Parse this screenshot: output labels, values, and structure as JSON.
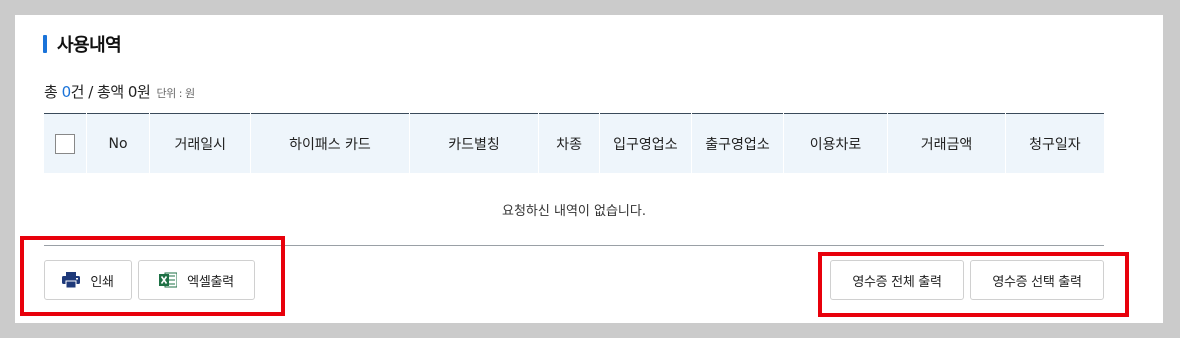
{
  "section": {
    "title": "사용내역"
  },
  "summary": {
    "total_prefix": "총 ",
    "count": "0",
    "count_suffix": "건 / 총액 ",
    "amount": "0",
    "amount_suffix": "원",
    "unit_label": "단위 : 원"
  },
  "table": {
    "columns": [
      "No",
      "거래일시",
      "하이패스 카드",
      "카드별칭",
      "차종",
      "입구영업소",
      "출구영업소",
      "이용차로",
      "거래금액",
      "청구일자"
    ],
    "empty_message": "요청하신 내역이 없습니다."
  },
  "actions": {
    "print_label": "인쇄",
    "excel_label": "엑셀출력",
    "receipt_all_label": "영수증 전체 출력",
    "receipt_selected_label": "영수증 선택 출력"
  },
  "colors": {
    "accent": "#1a73d9",
    "highlight": "#e8000b",
    "header_bg": "#eef5fb"
  },
  "icons": [
    "printer-icon",
    "excel-icon"
  ]
}
